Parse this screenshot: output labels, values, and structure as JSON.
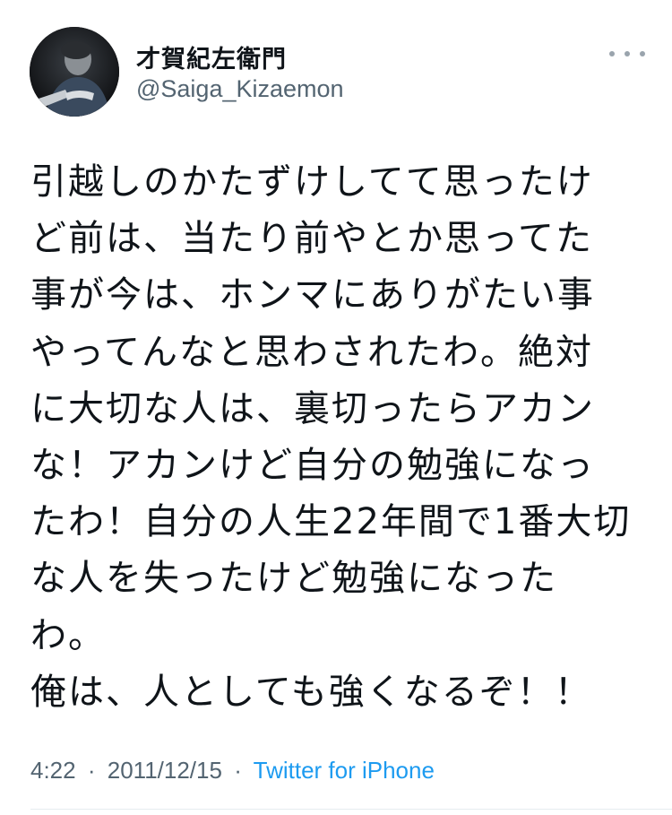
{
  "author": {
    "display_name": "才賀紀左衛門",
    "handle": "@Saiga_Kizaemon",
    "avatar_icon": "profile-photo"
  },
  "tweet": {
    "lines": [
      "引越しのかたずけしてて思ったけ",
      "ど前は、当たり前やとか思ってた",
      "事が今は、ホンマにありがたい事",
      "やってんなと思わされたわ。絶対",
      "に大切な人は、裏切ったらアカン",
      "な！アカンけど自分の勉強になっ",
      "たわ！自分の人生22年間で1番大切",
      "な人を失ったけど勉強になった",
      "わ。",
      "俺は、人としても強くなるぞ！！"
    ]
  },
  "meta": {
    "time": "4:22",
    "separator": "·",
    "date": "2011/12/15",
    "source": "Twitter for iPhone"
  },
  "colors": {
    "text": "#0f1419",
    "secondary": "#536471",
    "link": "#1d9bf0",
    "divider": "#e6ecf0"
  },
  "icons": {
    "more": "more-horizontal-icon"
  }
}
